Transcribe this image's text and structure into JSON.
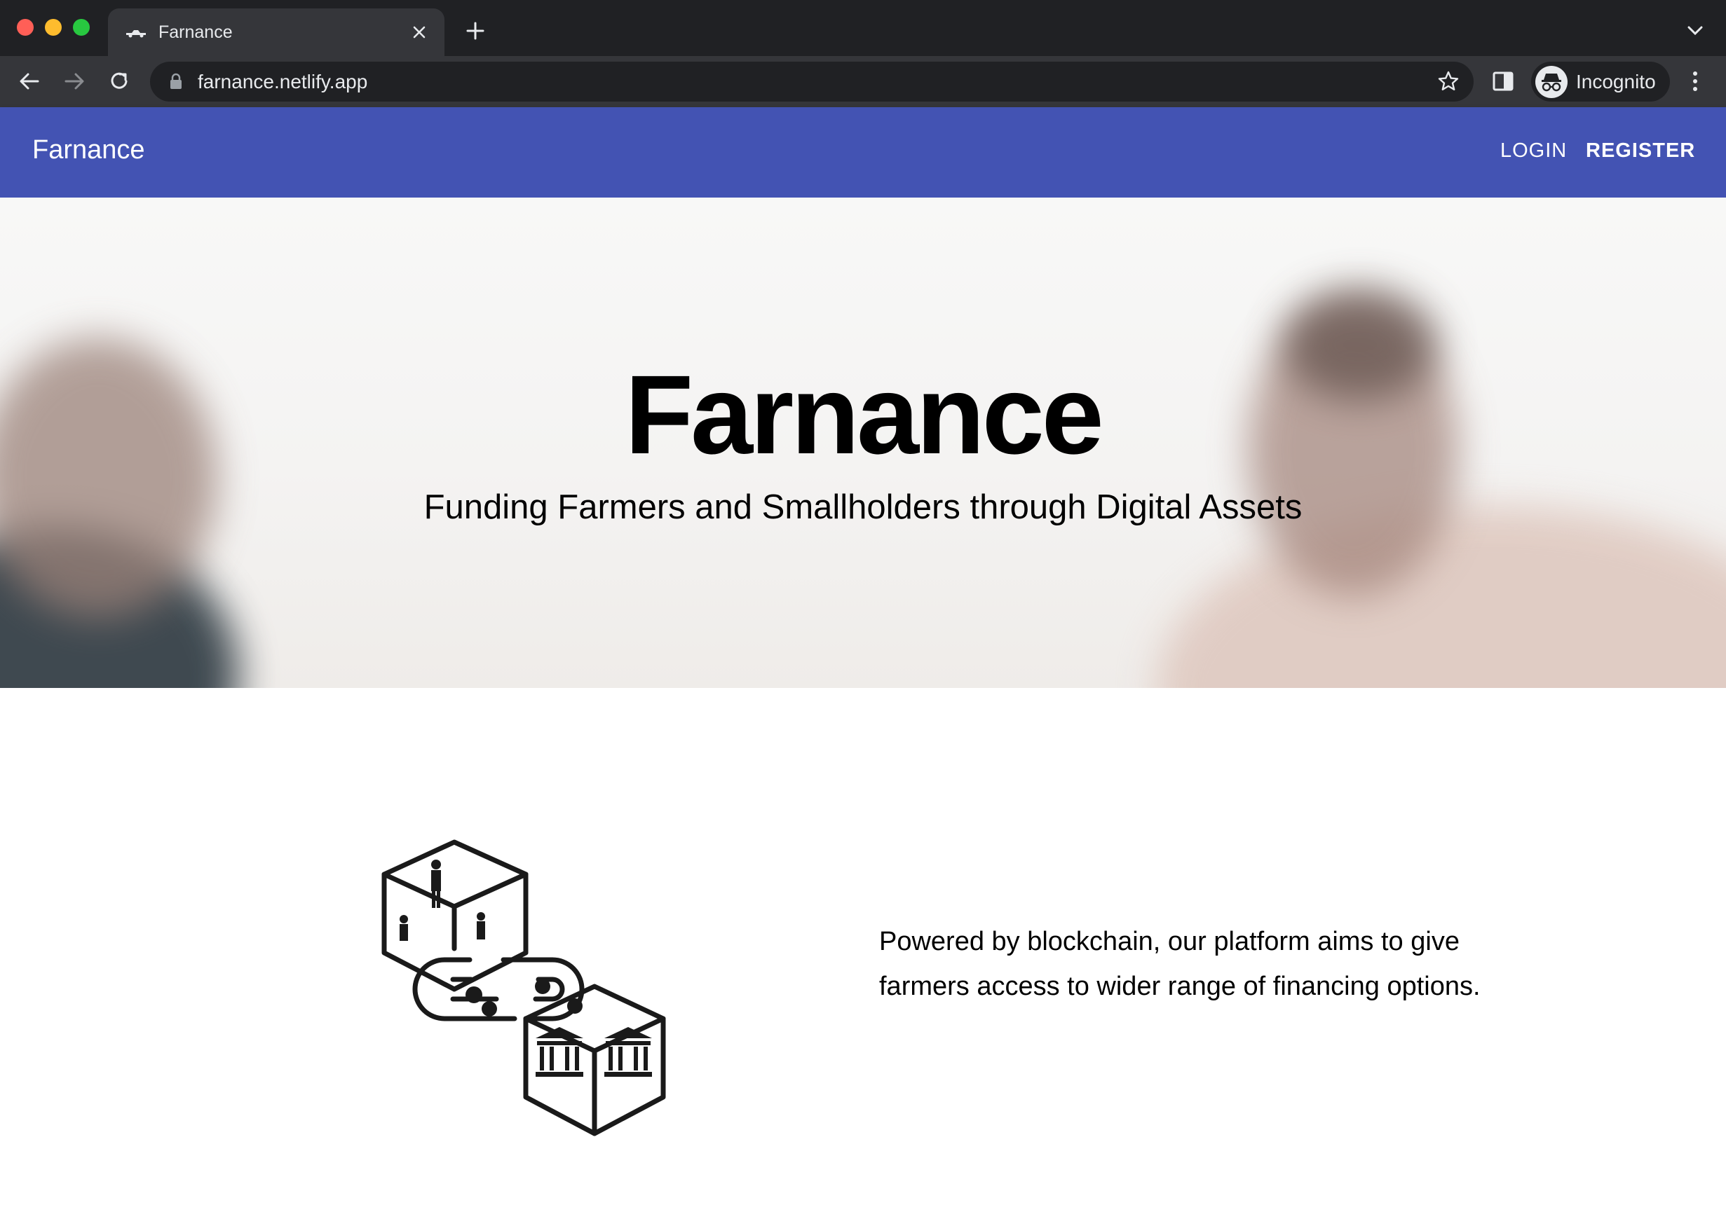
{
  "browser": {
    "tab": {
      "title": "Farnance",
      "favicon": "pickup-truck-icon"
    },
    "url": "farnance.netlify.app",
    "profile_label": "Incognito"
  },
  "site": {
    "brand": "Farnance",
    "nav": {
      "login": "LOGIN",
      "register": "REGISTER"
    },
    "brand_color": "#4353b3"
  },
  "hero": {
    "title": "Farnance",
    "subtitle": "Funding Farmers and Smallholders through Digital Assets"
  },
  "feature": {
    "illustration": "blockchain-farming-illustration",
    "text": "Powered by blockchain, our platform aims to give farmers access to wider range of financing options."
  }
}
